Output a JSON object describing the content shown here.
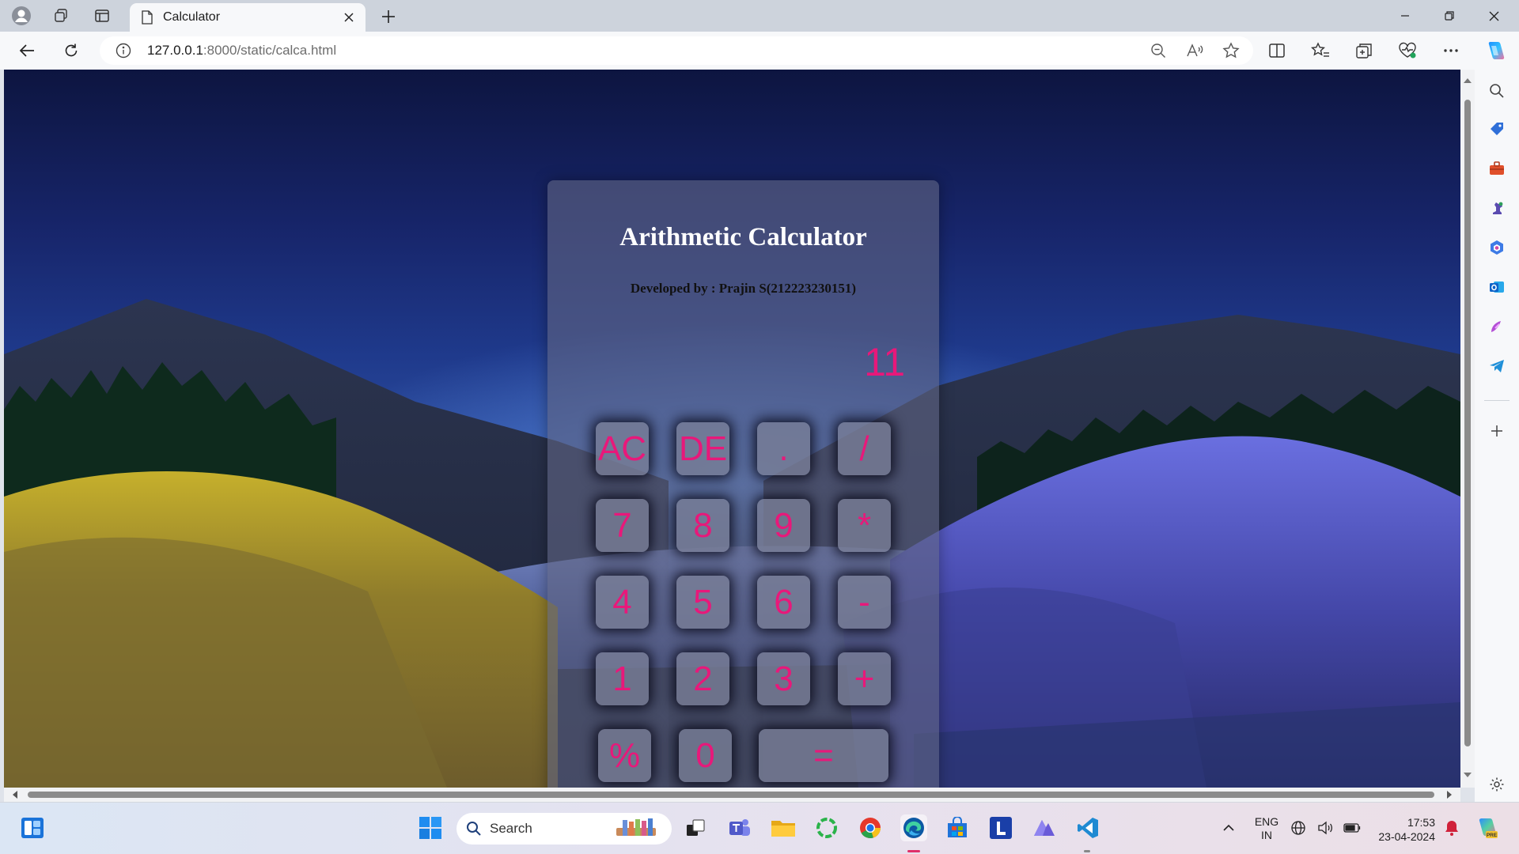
{
  "browser": {
    "tab": {
      "title": "Calculator"
    },
    "address": {
      "host": "127.0.0.1",
      "path": ":8000/static/calca.html"
    }
  },
  "calculator": {
    "title": "Arithmetic Calculator",
    "subtitle": "Developed by : Prajin S(212223230151)",
    "display": "11",
    "keys": {
      "ac": "AC",
      "de": "DE",
      "dot": ".",
      "div": "/",
      "k7": "7",
      "k8": "8",
      "k9": "9",
      "mul": "*",
      "k4": "4",
      "k5": "5",
      "k6": "6",
      "sub": "-",
      "k1": "1",
      "k2": "2",
      "k3": "3",
      "add": "+",
      "pct": "%",
      "k0": "0",
      "eq": "="
    }
  },
  "taskbar": {
    "search_label": "Search",
    "lang_top": "ENG",
    "lang_bottom": "IN",
    "time": "17:53",
    "date": "23-04-2024"
  },
  "colors": {
    "accent_pink": "#e8187a",
    "edge_blue": "#0c59a4"
  }
}
